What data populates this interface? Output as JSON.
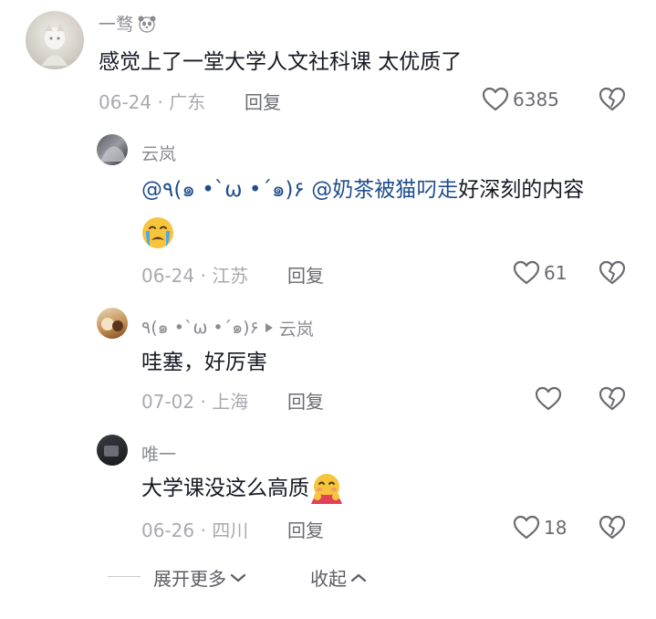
{
  "comments": [
    {
      "username": "一骛",
      "text": "感觉上了一堂大学人文社科课 太优质了",
      "date": "06-24",
      "location": "广东",
      "reply_label": "回复",
      "likes": "6385"
    },
    {
      "username": "云岚",
      "mention1": "@٩(๑ •`ω •´๑)۶",
      "mention2": "@奶茶被猫叼走",
      "text": "好深刻的内容",
      "date": "06-24",
      "location": "江苏",
      "reply_label": "回复",
      "likes": "61"
    },
    {
      "username": "٩(๑ •`ω •´๑)۶",
      "reply_to": "云岚",
      "text": "哇塞，好厉害",
      "date": "07-02",
      "location": "上海",
      "reply_label": "回复",
      "likes": ""
    },
    {
      "username": "唯一",
      "text": "大学课没这么高质",
      "date": "06-26",
      "location": "四川",
      "reply_label": "回复",
      "likes": "18"
    }
  ],
  "footer": {
    "expand_label": "展开更多",
    "collapse_label": "收起"
  },
  "separator": "·",
  "colors": {
    "mention": "#1f4e8c",
    "meta": "#a9aab0",
    "text": "#161823"
  }
}
